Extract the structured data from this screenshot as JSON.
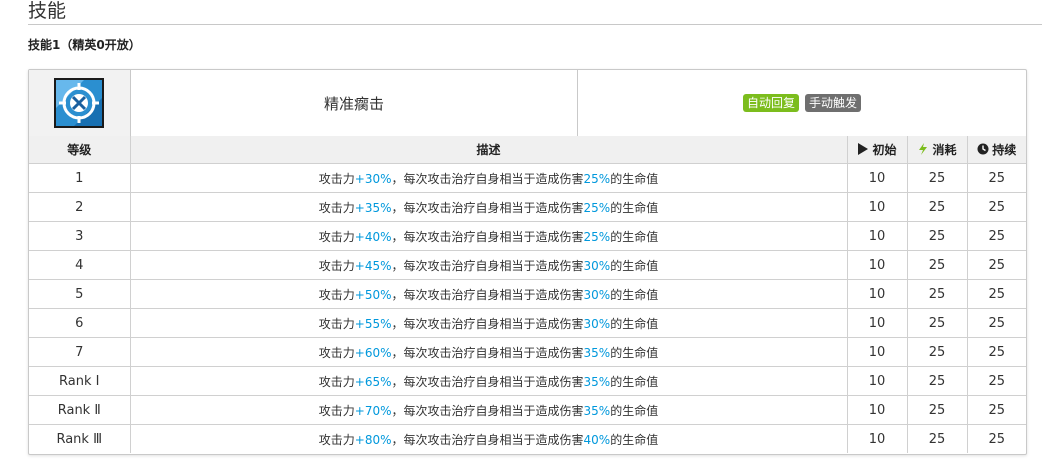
{
  "section": {
    "title": "技能",
    "subtitle": "技能1（精英0开放）"
  },
  "skill": {
    "name": "精准瘸击",
    "tags": [
      {
        "label": "自动回复",
        "color": "#7cbd1d"
      },
      {
        "label": "手动触发",
        "color": "#6f6f6f"
      }
    ],
    "icon": "skill-crosshair-icon"
  },
  "table": {
    "headers": {
      "level": "等级",
      "description": "描述",
      "initial": "初始",
      "cost": "消耗",
      "duration": "持续"
    },
    "header_icons": {
      "initial": "play-icon",
      "cost": "lightning-icon",
      "duration": "clock-icon"
    },
    "desc_parts": {
      "pre": "攻击力",
      "mid": "，每次攻击治疗自身相当于造成伤害",
      "post": "的生命值"
    },
    "highlight_color": "#0098dc",
    "rows": [
      {
        "level": "1",
        "atk": "+30%",
        "heal": "25%",
        "initial": "10",
        "cost": "25",
        "duration": "25"
      },
      {
        "level": "2",
        "atk": "+35%",
        "heal": "25%",
        "initial": "10",
        "cost": "25",
        "duration": "25"
      },
      {
        "level": "3",
        "atk": "+40%",
        "heal": "25%",
        "initial": "10",
        "cost": "25",
        "duration": "25"
      },
      {
        "level": "4",
        "atk": "+45%",
        "heal": "30%",
        "initial": "10",
        "cost": "25",
        "duration": "25"
      },
      {
        "level": "5",
        "atk": "+50%",
        "heal": "30%",
        "initial": "10",
        "cost": "25",
        "duration": "25"
      },
      {
        "level": "6",
        "atk": "+55%",
        "heal": "30%",
        "initial": "10",
        "cost": "25",
        "duration": "25"
      },
      {
        "level": "7",
        "atk": "+60%",
        "heal": "35%",
        "initial": "10",
        "cost": "25",
        "duration": "25"
      },
      {
        "level": "Rank Ⅰ",
        "atk": "+65%",
        "heal": "35%",
        "initial": "10",
        "cost": "25",
        "duration": "25"
      },
      {
        "level": "Rank Ⅱ",
        "atk": "+70%",
        "heal": "35%",
        "initial": "10",
        "cost": "25",
        "duration": "25"
      },
      {
        "level": "Rank Ⅲ",
        "atk": "+80%",
        "heal": "40%",
        "initial": "10",
        "cost": "25",
        "duration": "25"
      }
    ]
  }
}
